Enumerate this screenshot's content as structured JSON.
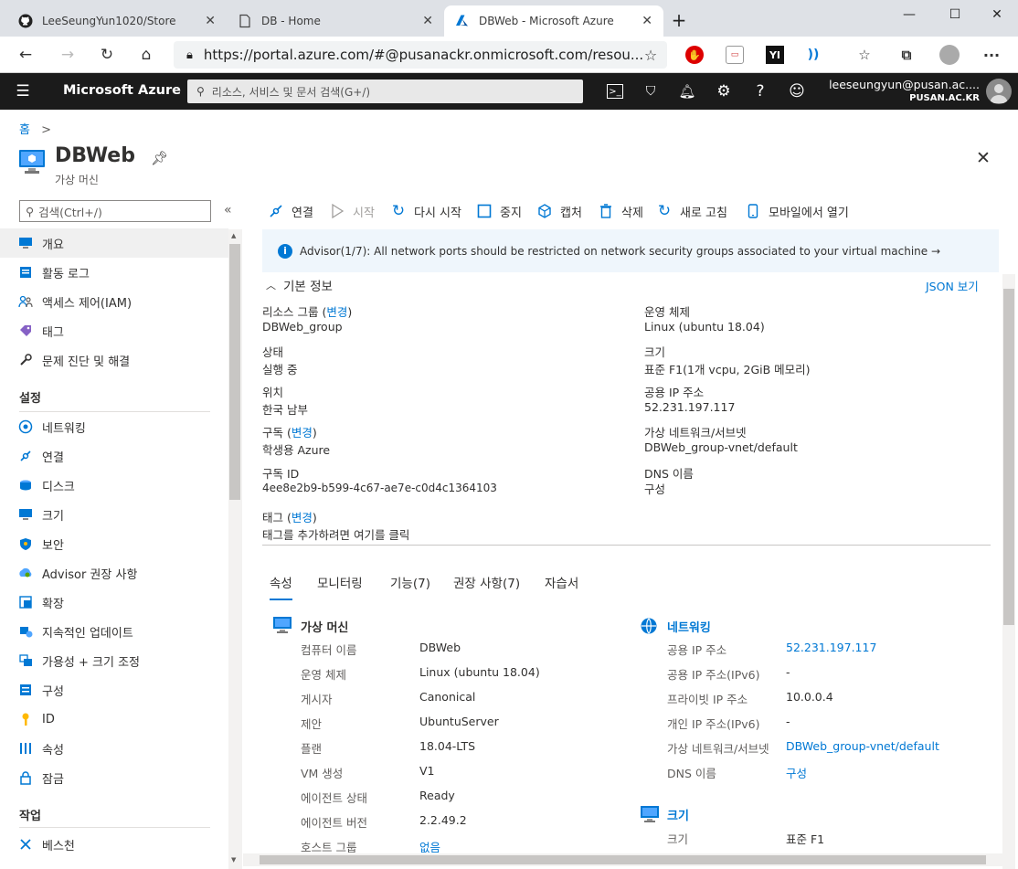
{
  "browser": {
    "tabs": [
      {
        "label": "LeeSeungYun1020/Store",
        "icon": "github-icon"
      },
      {
        "label": "DB - Home",
        "icon": "page-icon"
      },
      {
        "label": "DBWeb - Microsoft Azure",
        "icon": "azure-icon"
      }
    ],
    "url": "https://portal.azure.com/#@pusanackr.onmicrosoft.com/resou..."
  },
  "azure_bar": {
    "brand": "Microsoft Azure",
    "search_placeholder": "리소스, 서비스 및 문서 검색(G+/)",
    "user_email": "leeseungyun@pusan.ac....",
    "user_org": "PUSAN.AC.KR"
  },
  "breadcrumb": {
    "home": "홈",
    "sep": ">"
  },
  "resource": {
    "name": "DBWeb",
    "type": "가상 머신"
  },
  "sidebar": {
    "search_placeholder": "검색(Ctrl+/)",
    "items_top": [
      {
        "label": "개요",
        "icon": "monitor-icon"
      },
      {
        "label": "활동 로그",
        "icon": "log-icon"
      },
      {
        "label": "액세스 제어(IAM)",
        "icon": "people-icon"
      },
      {
        "label": "태그",
        "icon": "tag-icon"
      },
      {
        "label": "문제 진단 및 해결",
        "icon": "wrench-icon"
      }
    ],
    "section_settings": "설정",
    "items_settings": [
      {
        "label": "네트워킹",
        "icon": "network-icon"
      },
      {
        "label": "연결",
        "icon": "connect-icon"
      },
      {
        "label": "디스크",
        "icon": "disk-icon"
      },
      {
        "label": "크기",
        "icon": "size-icon"
      },
      {
        "label": "보안",
        "icon": "shield-icon"
      },
      {
        "label": "Advisor 권장 사항",
        "icon": "advisor-icon"
      },
      {
        "label": "확장",
        "icon": "extension-icon"
      },
      {
        "label": "지속적인 업데이트",
        "icon": "update-icon"
      },
      {
        "label": "가용성 + 크기 조정",
        "icon": "availability-icon"
      },
      {
        "label": "구성",
        "icon": "config-icon"
      },
      {
        "label": "ID",
        "icon": "key-icon"
      },
      {
        "label": "속성",
        "icon": "properties-icon"
      },
      {
        "label": "잠금",
        "icon": "lock-icon"
      }
    ],
    "section_ops": "작업",
    "items_ops": [
      {
        "label": "베스천",
        "icon": "bastion-icon"
      }
    ]
  },
  "toolbar": {
    "connect": "연결",
    "start": "시작",
    "restart": "다시 시작",
    "stop": "중지",
    "capture": "캡처",
    "delete": "삭제",
    "refresh": "새로 고침",
    "mobile": "모바일에서 열기"
  },
  "advisor_banner": "Advisor(1/7): All network ports should be restricted on network security groups associated to your virtual machine →",
  "essentials": {
    "title": "기본 정보",
    "json_view": "JSON 보기",
    "change": "변경",
    "left": {
      "rg_label": "리소스 그룹 (",
      "rg_label_end": ")",
      "rg_value": "DBWeb_group",
      "status_label": "상태",
      "status_value": "실행 중",
      "location_label": "위치",
      "location_value": "한국 남부",
      "sub_label": "구독 (",
      "sub_label_end": ")",
      "sub_value": "학생용 Azure",
      "subid_label": "구독 ID",
      "subid_value": "4ee8e2b9-b599-4c67-ae7e-c0d4c1364103",
      "tags_label": "태그 (",
      "tags_label_end": ")",
      "tags_value": "태그를 추가하려면 여기를 클릭"
    },
    "right": {
      "os_label": "운영 체제",
      "os_value": "Linux (ubuntu 18.04)",
      "size_label": "크기",
      "size_value": "표준 F1(1개 vcpu, 2GiB 메모리)",
      "pip_label": "공용 IP 주소",
      "pip_value": "52.231.197.117",
      "vnet_label": "가상 네트워크/서브넷",
      "vnet_value": "DBWeb_group-vnet/default",
      "dns_label": "DNS 이름",
      "dns_value": "구성"
    }
  },
  "detail_tabs": [
    "속성",
    "모니터링",
    "기능(7)",
    "권장 사항(7)",
    "자습서"
  ],
  "vm_section": {
    "title": "가상 머신",
    "rows": [
      {
        "k": "컴퓨터 이름",
        "v": "DBWeb"
      },
      {
        "k": "운영 체제",
        "v": "Linux (ubuntu 18.04)"
      },
      {
        "k": "게시자",
        "v": "Canonical"
      },
      {
        "k": "제안",
        "v": "UbuntuServer"
      },
      {
        "k": "플랜",
        "v": "18.04-LTS"
      },
      {
        "k": "VM 생성",
        "v": "V1"
      },
      {
        "k": "에이전트 상태",
        "v": "Ready"
      },
      {
        "k": "에이전트 버전",
        "v": "2.2.49.2"
      },
      {
        "k": "호스트 그룹",
        "v": "없음"
      }
    ]
  },
  "net_section": {
    "title": "네트워킹",
    "rows": [
      {
        "k": "공용 IP 주소",
        "v": "52.231.197.117"
      },
      {
        "k": "공용 IP 주소(IPv6)",
        "v": "-"
      },
      {
        "k": "프라이빗 IP 주소",
        "v": "10.0.0.4"
      },
      {
        "k": "개인 IP 주소(IPv6)",
        "v": "-"
      },
      {
        "k": "가상 네트워크/서브넷",
        "v": "DBWeb_group-vnet/default"
      },
      {
        "k": "DNS 이름",
        "v": "구성"
      }
    ]
  },
  "size_section": {
    "title": "크기",
    "rows": [
      {
        "k": "크기",
        "v": "표준 F1"
      }
    ]
  },
  "colors": {
    "azure_blue": "#0078d4",
    "topbar": "#1b1b1b"
  }
}
